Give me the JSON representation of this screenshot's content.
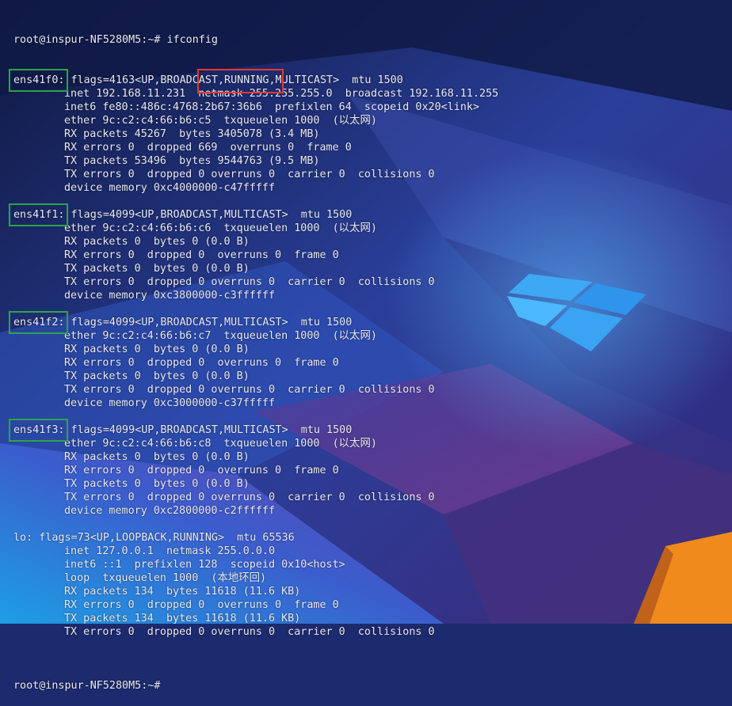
{
  "colors": {
    "text": "#e9e9f2",
    "highlight_green": "#2fa24a",
    "highlight_red": "#e03a3a",
    "windows_logo": "#3ea8f5",
    "accent_orange": "#f08a1c"
  },
  "terminal": {
    "prompt_top": "root@inspur-NF5280M5:~# ifconfig",
    "interfaces": [
      {
        "name": "ens41f0:",
        "header": " flags=4163<UP,BROADCAST,RUNNING,MULTICAST>  mtu 1500",
        "lines": [
          "inet 192.168.11.231  netmask 255.255.255.0  broadcast 192.168.11.255",
          "inet6 fe80::486c:4768:2b67:36b6  prefixlen 64  scopeid 0x20<link>",
          "ether 9c:c2:c4:66:b6:c5  txqueuelen 1000  (以太网)",
          "RX packets 45267  bytes 3405078 (3.4 MB)",
          "RX errors 0  dropped 669  overruns 0  frame 0",
          "TX packets 53496  bytes 9544763 (9.5 MB)",
          "TX errors 0  dropped 0 overruns 0  carrier 0  collisions 0",
          "device memory 0xc4000000-c47fffff"
        ]
      },
      {
        "name": "ens41f1:",
        "header": " flags=4099<UP,BROADCAST,MULTICAST>  mtu 1500",
        "lines": [
          "ether 9c:c2:c4:66:b6:c6  txqueuelen 1000  (以太网)",
          "RX packets 0  bytes 0 (0.0 B)",
          "RX errors 0  dropped 0  overruns 0  frame 0",
          "TX packets 0  bytes 0 (0.0 B)",
          "TX errors 0  dropped 0 overruns 0  carrier 0  collisions 0",
          "device memory 0xc3800000-c3ffffff"
        ]
      },
      {
        "name": "ens41f2:",
        "header": " flags=4099<UP,BROADCAST,MULTICAST>  mtu 1500",
        "lines": [
          "ether 9c:c2:c4:66:b6:c7  txqueuelen 1000  (以太网)",
          "RX packets 0  bytes 0 (0.0 B)",
          "RX errors 0  dropped 0  overruns 0  frame 0",
          "TX packets 0  bytes 0 (0.0 B)",
          "TX errors 0  dropped 0 overruns 0  carrier 0  collisions 0",
          "device memory 0xc3000000-c37fffff"
        ]
      },
      {
        "name": "ens41f3:",
        "header": " flags=4099<UP,BROADCAST,MULTICAST>  mtu 1500",
        "lines": [
          "ether 9c:c2:c4:66:b6:c8  txqueuelen 1000  (以太网)",
          "RX packets 0  bytes 0 (0.0 B)",
          "RX errors 0  dropped 0  overruns 0  frame 0",
          "TX packets 0  bytes 0 (0.0 B)",
          "TX errors 0  dropped 0 overruns 0  carrier 0  collisions 0",
          "device memory 0xc2800000-c2ffffff"
        ]
      },
      {
        "name": "lo:",
        "header": " flags=73<UP,LOOPBACK,RUNNING>  mtu 65536",
        "lines": [
          "inet 127.0.0.1  netmask 255.0.0.0",
          "inet6 ::1  prefixlen 128  scopeid 0x10<host>",
          "loop  txqueuelen 1000  (本地环回)",
          "RX packets 134  bytes 11618 (11.6 KB)",
          "RX errors 0  dropped 0  overruns 0  frame 0",
          "TX packets 134  bytes 11618 (11.6 KB)",
          "TX errors 0  dropped 0 overruns 0  carrier 0  collisions 0"
        ]
      }
    ],
    "prompt_bottom": "root@inspur-NF5280M5:~# "
  }
}
